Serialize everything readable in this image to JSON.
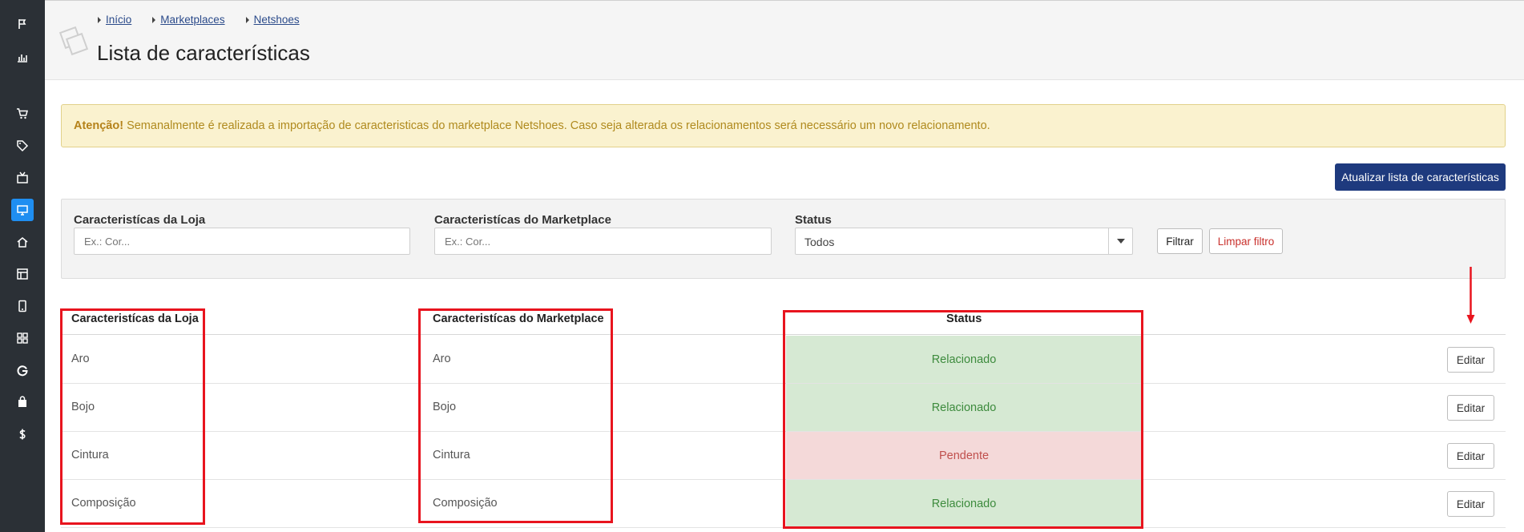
{
  "sidebar": {
    "icons": [
      "flag-icon",
      "bar-chart-icon",
      "cart-icon",
      "tag-icon",
      "tv-icon",
      "monitor-icon",
      "home-icon",
      "layout-icon",
      "mobile-icon",
      "grid-icon",
      "google-icon",
      "bag-icon",
      "dollar-icon"
    ],
    "active": "monitor-icon"
  },
  "breadcrumb": [
    "Início",
    "Marketplaces",
    "Netshoes"
  ],
  "page": {
    "title": "Lista de características"
  },
  "alert": {
    "strong": "Atenção!",
    "text": " Semanalmente é realizada a importação de caracteristicas do marketplace Netshoes. Caso seja alterada os relacionamentos será necessário um novo relacionamento."
  },
  "actions": {
    "update_button": "Atualizar lista de características"
  },
  "filters": {
    "store_label": "Caracteristícas da Loja",
    "store_placeholder": "Ex.: Cor...",
    "marketplace_label": "Caracteristícas do Marketplace",
    "marketplace_placeholder": "Ex.: Cor...",
    "status_label": "Status",
    "status_value": "Todos",
    "filter_button": "Filtrar",
    "clear_button": "Limpar filtro"
  },
  "table": {
    "headers": {
      "store": "Caracteristícas da Loja",
      "marketplace": "Caracteristícas do Marketplace",
      "status": "Status"
    },
    "edit_label": "Editar",
    "rows": [
      {
        "store": "Aro",
        "marketplace": "Aro",
        "status": "Relacionado"
      },
      {
        "store": "Bojo",
        "marketplace": "Bojo",
        "status": "Relacionado"
      },
      {
        "store": "Cintura",
        "marketplace": "Cintura",
        "status": "Pendente"
      },
      {
        "store": "Composição",
        "marketplace": "Composição",
        "status": "Relacionado"
      }
    ]
  },
  "colors": {
    "sidebar_bg": "#2b3036",
    "primary": "#1e3a7e",
    "status_ok_bg": "#d6e9d3",
    "status_pending_bg": "#f4d9d9",
    "annotation_red": "#e8141e"
  }
}
